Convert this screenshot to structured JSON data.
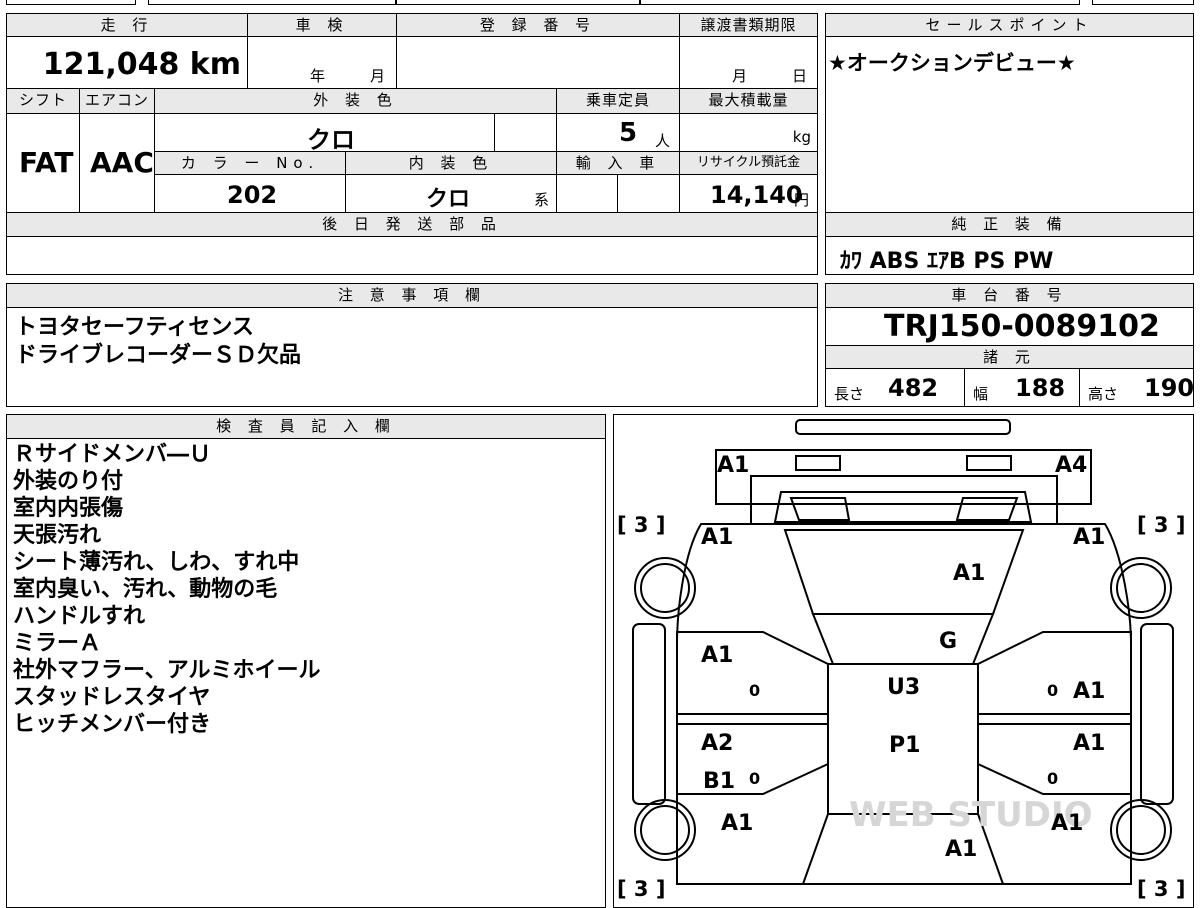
{
  "top_table": {
    "mileage_header": "走 行",
    "mileage_value": "121,048 km",
    "shaken_header": "車 検",
    "shaken_year_unit": "年",
    "shaken_month_unit": "月",
    "registration_header": "登 録 番 号",
    "transfer_header": "譲渡書類期限",
    "transfer_month_unit": "月",
    "transfer_day_unit": "日",
    "shift_header": "シフト",
    "shift_value": "FAT",
    "aircon_header": "エアコン",
    "aircon_value": "AAC",
    "exterior_color_header": "外 装 色",
    "exterior_color_value": "クロ",
    "capacity_header": "乗車定員",
    "capacity_value": "5",
    "capacity_unit": "人",
    "max_load_header": "最大積載量",
    "max_load_unit": "kg",
    "color_no_header": "カ ラ ー No.",
    "color_no_value": "202",
    "interior_color_header": "内 装 色",
    "interior_color_value": "クロ",
    "interior_color_suffix": "系",
    "import_header": "輸 入 車",
    "recycle_header": "リサイクル預託金",
    "recycle_value": "14,140",
    "recycle_unit": "円",
    "later_parts_header": "後 日 発 送 部 品"
  },
  "sales_point": {
    "header": "セールスポイント",
    "text": "★オークションデビュー★"
  },
  "genuine_equipment": {
    "header": "純 正 装 備",
    "text": "ｶﾜ ABS ｴｱB PS PW"
  },
  "notes": {
    "header": "注 意 事 項 欄",
    "lines": [
      "トヨタセーフティセンス",
      "ドライブレコーダーＳＤ欠品"
    ]
  },
  "chassis": {
    "header": "車 台 番 号",
    "value": "TRJ150-0089102"
  },
  "specs": {
    "header": "諸 元",
    "length_label": "長さ",
    "length_value": "482",
    "width_label": "幅",
    "width_value": "188",
    "height_label": "高さ",
    "height_value": "190"
  },
  "inspector": {
    "header": "検 査 員 記 入 欄",
    "lines": [
      "Ｒサイドメンバ―Ｕ",
      "外装のり付",
      "室内内張傷",
      "天張汚れ",
      "シート薄汚れ、しわ、すれ中",
      "室内臭い、汚れ、動物の毛",
      "ハンドルすれ",
      "ミラーＡ",
      "社外マフラー、アルミホイール",
      "スタッドレスタイヤ",
      "ヒッチメンバー付き"
    ]
  },
  "diagram": {
    "tire_marks": [
      "[ 3 ]",
      "[ 3 ]",
      "[ 3 ]",
      "[ 3 ]"
    ],
    "labels": [
      "A1",
      "A4",
      "A1",
      "A1",
      "A1",
      "G",
      "A1",
      "U3",
      "A1",
      "A2",
      "P1",
      "A1",
      "B1",
      "A1",
      "A1",
      "A1"
    ],
    "zero_marks": [
      "0",
      "0",
      "0",
      "0"
    ],
    "watermark": "WEB STUDIO"
  }
}
